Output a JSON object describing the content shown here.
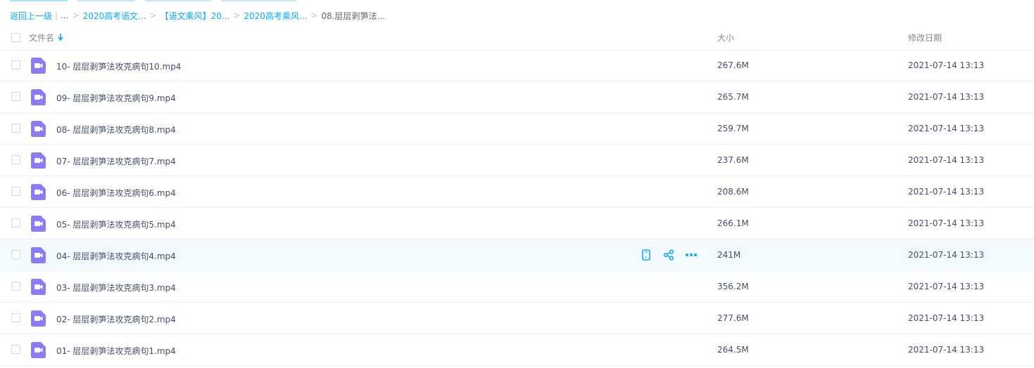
{
  "breadcrumb": {
    "back_label": "返回上一级",
    "pipe": "|",
    "ellipsis": "...",
    "separator": ">",
    "items": [
      {
        "label": "2020高考语文..."
      },
      {
        "label": "【语文乘风】20..."
      },
      {
        "label": "2020高考乘风..."
      }
    ],
    "current": "08.层层剥笋法..."
  },
  "header": {
    "name_label": "文件名",
    "sort_icon": "arrow-down-icon",
    "size_label": "大小",
    "date_label": "修改日期"
  },
  "colors": {
    "accent": "#09aaff",
    "video_icon": "#8b7cf6",
    "hover_row": "#f4fbff"
  },
  "files": [
    {
      "name": "10- 层层剥笋法攻克病句10.mp4",
      "size": "267.6M",
      "date": "2021-07-14 13:13",
      "icon": "video-file-icon"
    },
    {
      "name": "09- 层层剥笋法攻克病句9.mp4",
      "size": "265.7M",
      "date": "2021-07-14 13:13",
      "icon": "video-file-icon"
    },
    {
      "name": "08- 层层剥笋法攻克病句8.mp4",
      "size": "259.7M",
      "date": "2021-07-14 13:13",
      "icon": "video-file-icon"
    },
    {
      "name": "07- 层层剥笋法攻克病句7.mp4",
      "size": "237.6M",
      "date": "2021-07-14 13:13",
      "icon": "video-file-icon"
    },
    {
      "name": "06- 层层剥笋法攻克病句6.mp4",
      "size": "208.6M",
      "date": "2021-07-14 13:13",
      "icon": "video-file-icon"
    },
    {
      "name": "05- 层层剥笋法攻克病句5.mp4",
      "size": "266.1M",
      "date": "2021-07-14 13:13",
      "icon": "video-file-icon"
    },
    {
      "name": "04- 层层剥笋法攻克病句4.mp4",
      "size": "241M",
      "date": "2021-07-14 13:13",
      "icon": "video-file-icon",
      "hovered": true,
      "actions": [
        "phone-icon",
        "share-icon",
        "more-icon"
      ]
    },
    {
      "name": "03- 层层剥笋法攻克病句3.mp4",
      "size": "356.2M",
      "date": "2021-07-14 13:13",
      "icon": "video-file-icon"
    },
    {
      "name": "02- 层层剥笋法攻克病句2.mp4",
      "size": "277.6M",
      "date": "2021-07-14 13:13",
      "icon": "video-file-icon"
    },
    {
      "name": "01- 层层剥笋法攻克病句1.mp4",
      "size": "264.5M",
      "date": "2021-07-14 13:13",
      "icon": "video-file-icon"
    }
  ]
}
